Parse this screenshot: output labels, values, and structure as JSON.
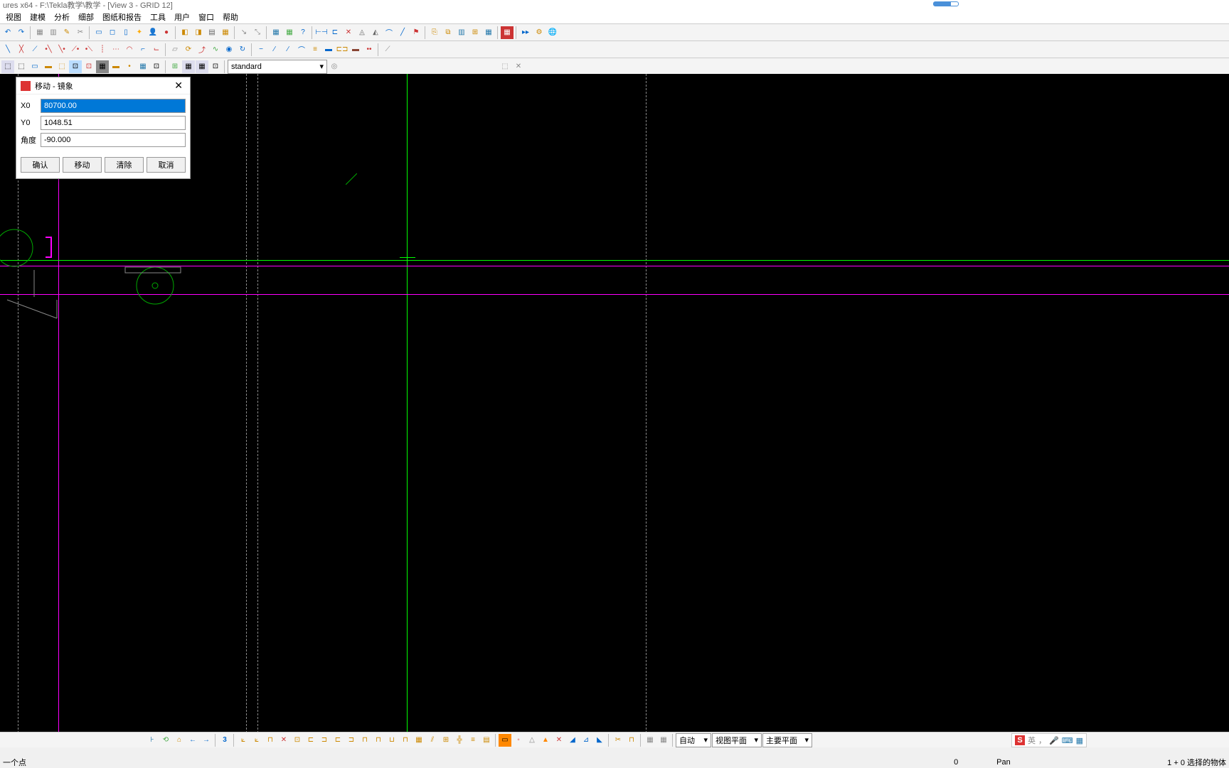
{
  "title": "ures x64 - F:\\Tekla教学\\教学  - [View 3 - GRID 12]",
  "menus": [
    "视图",
    "建模",
    "分析",
    "细部",
    "图纸和报告",
    "工具",
    "用户",
    "窗口",
    "帮助"
  ],
  "dropdown_standard": "standard",
  "dialog": {
    "title": "移动 - 镜象",
    "fields": {
      "x0_label": "X0",
      "x0_value": "80700.00",
      "y0_label": "Y0",
      "y0_value": "1048.51",
      "angle_label": "角度",
      "angle_value": "-90.000"
    },
    "buttons": {
      "ok": "确认",
      "move": "移动",
      "clear": "清除",
      "cancel": "取消"
    }
  },
  "bottom_dropdowns": {
    "auto": "自动",
    "view_plane": "视图平面",
    "main_plane": "主要平面"
  },
  "status": {
    "left": "一个点",
    "coord": "0",
    "mode": "Pan",
    "right": "1 + 0 选择的物体"
  },
  "ime": {
    "brand": "S",
    "lang": "英"
  }
}
